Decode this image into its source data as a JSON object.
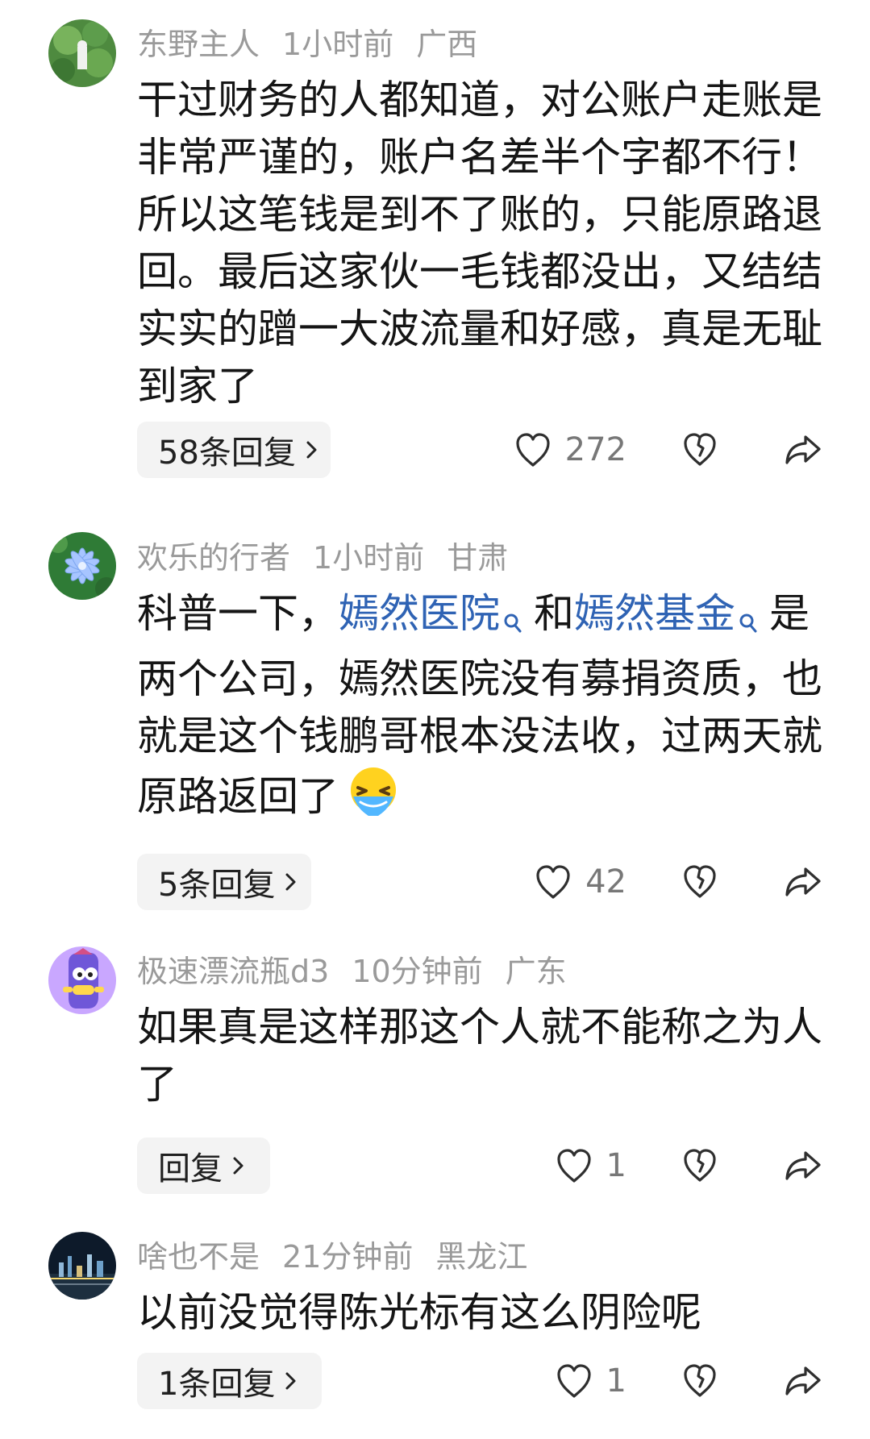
{
  "comments": [
    {
      "username": "东野主人",
      "time": "1小时前",
      "location": "广西",
      "text": "干过财务的人都知道，对公账户走账是非常严谨的，账户名差半个字都不行！所以这笔钱是到不了账的，只能原路退回。最后这家伙一毛钱都没出，又结结实实的蹭一大波流量和好感，真是无耻到家了",
      "reply_label": "58条回复",
      "likes": "272",
      "avatar_icon": "lotus-pond-avatar"
    },
    {
      "username": "欢乐的行者",
      "time": "1小时前",
      "location": "甘肃",
      "text_parts": {
        "prefix": "科普一下，",
        "link1": "嫣然医院",
        "middle": "和",
        "link2": "嫣然基金",
        "suffix": "是两个公司，嫣然医院没有募捐资质，也就是这个钱鹏哥根本没法收，过两天就原路返回了"
      },
      "emoji": "crying-face-emoji",
      "reply_label": "5条回复",
      "likes": "42",
      "avatar_icon": "blue-flower-avatar"
    },
    {
      "username": "极速漂流瓶d3",
      "time": "10分钟前",
      "location": "广东",
      "text": "如果真是这样那这个人就不能称之为人了",
      "reply_label": "回复",
      "likes": "1",
      "avatar_icon": "purple-cartoon-avatar"
    },
    {
      "username": "啥也不是",
      "time": "21分钟前",
      "location": "黑龙江",
      "text": "以前没觉得陈光标有这么阴险呢",
      "reply_label": "1条回复",
      "likes": "1",
      "avatar_icon": "night-city-avatar"
    }
  ],
  "colors": {
    "meta": "#9a9a9a",
    "link": "#2f63b4",
    "reply_bg": "#f3f3f3",
    "text": "#151515"
  },
  "icons": {
    "like": "heart-outline-icon",
    "dislike": "broken-heart-icon",
    "share": "share-arrow-icon",
    "search": "search-icon",
    "chevron": "chevron-right-icon"
  }
}
